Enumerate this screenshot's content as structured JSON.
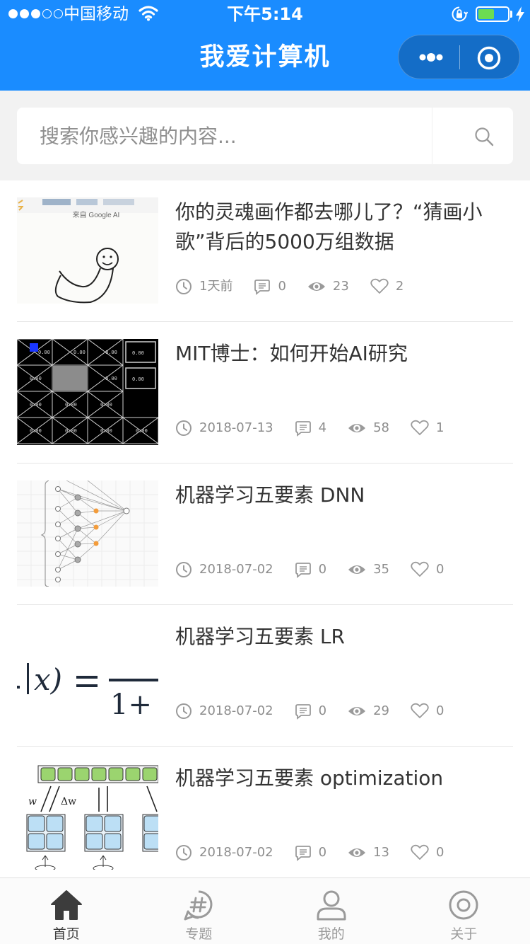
{
  "status": {
    "carrier": "中国移动",
    "time": "下午5:14",
    "battery_level": 0.55
  },
  "nav": {
    "title": "我爱计算机",
    "more_icon": "more-dots-icon",
    "close_icon": "capsule-target-icon"
  },
  "search": {
    "placeholder": "搜索你感兴趣的内容..."
  },
  "articles": [
    {
      "title": "你的灵魂画作都去哪儿了？“猜画小歌”背后的5000万组数据",
      "time": "1天前",
      "comments": "0",
      "views": "23",
      "likes": "2",
      "thumb_caption": "来自 Google AI"
    },
    {
      "title": "MIT博士：如何开始AI研究",
      "time": "2018-07-13",
      "comments": "4",
      "views": "58",
      "likes": "1"
    },
    {
      "title": "机器学习五要素 DNN",
      "time": "2018-07-02",
      "comments": "0",
      "views": "35",
      "likes": "0"
    },
    {
      "title": "机器学习五要素 LR",
      "time": "2018-07-02",
      "comments": "0",
      "views": "29",
      "likes": "0"
    },
    {
      "title": "机器学习五要素 optimization",
      "time": "2018-07-02",
      "comments": "0",
      "views": "13",
      "likes": "0"
    }
  ],
  "tabs": [
    {
      "label": "首页",
      "icon": "home-icon",
      "active": true
    },
    {
      "label": "专题",
      "icon": "topic-hash-icon",
      "active": false
    },
    {
      "label": "我的",
      "icon": "user-icon",
      "active": false
    },
    {
      "label": "关于",
      "icon": "about-icon",
      "active": false
    }
  ],
  "colors": {
    "brand": "#1a8cff",
    "meta": "#8d8d8d",
    "title": "#333333",
    "battery": "#6cdc52"
  }
}
